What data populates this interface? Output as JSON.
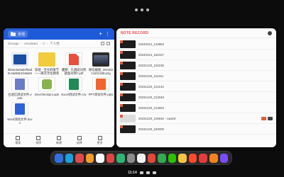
{
  "file_manager": {
    "header_label": "本地",
    "path": [
      "Storage",
      "emulated",
      "0",
      "个人档"
    ],
    "files": [
      {
        "caption": "3b0ac5e9ab0f83d0c4ad6ab1fa5a84d9ec5a5...",
        "kind": "image"
      },
      {
        "caption": "穿越 · 宝主的暖节——麻苏文化教育",
        "kind": "folder"
      },
      {
        "caption": "董卿：礼貌面对周题面对啊?.pdf",
        "kind": "pdf"
      },
      {
        "caption": "微信截图_20240314101458.png",
        "kind": "screenshot"
      },
      {
        "caption": "古迷信测试文件.epub",
        "kind": "epub"
      },
      {
        "caption": "DevCheckpro.apk",
        "kind": "apk"
      },
      {
        "caption": "Excel测试文件.csv",
        "kind": "csv"
      },
      {
        "caption": "PPT测试文件.pptx",
        "kind": "pptx"
      },
      {
        "caption": "Word测试文件.docx",
        "kind": "docx"
      }
    ],
    "bottom": [
      "搜索",
      "排序",
      "新建",
      "选择",
      "更多"
    ]
  },
  "notes": {
    "title": "NOTE RECORD",
    "rows": [
      {
        "name": "20240314_143853"
      },
      {
        "name": "20240314_150437"
      },
      {
        "name": "20231220_210235"
      },
      {
        "name": "20231220_211311"
      },
      {
        "name": "20231220_212142"
      },
      {
        "name": "20231220_213048"
      },
      {
        "name": "20231220_213553"
      },
      {
        "name": "20231220_215845 - copied"
      },
      {
        "name": "20231220_220005"
      }
    ]
  },
  "dock": {
    "apps": [
      {
        "name": "browser-icon",
        "color": "#2f6fe0"
      },
      {
        "name": "bird-icon",
        "color": "#1aa1e0"
      },
      {
        "name": "dual-icon",
        "color": "#e24a4a"
      },
      {
        "name": "photos-icon",
        "color": "#f29b2b"
      },
      {
        "name": "camera-icon",
        "color": "#ffffff"
      },
      {
        "name": "message-icon",
        "color": "#e24545"
      },
      {
        "name": "green-app-icon",
        "color": "#2bb673"
      },
      {
        "name": "settings-icon",
        "color": "#8b8b8b"
      },
      {
        "name": "clock-icon",
        "color": "#f2f2f2"
      },
      {
        "name": "app-store-icon",
        "color": "#e8453c"
      },
      {
        "name": "chrome-icon",
        "color": "#34a853"
      },
      {
        "name": "wechat-icon",
        "color": "#2dc100"
      },
      {
        "name": "notes-icon",
        "color": "#f5c542"
      },
      {
        "name": "office-icon",
        "color": "#ff4b2b"
      },
      {
        "name": "wps-icon",
        "color": "#e63b3b"
      },
      {
        "name": "media-icon",
        "color": "#f58220"
      },
      {
        "name": "music-icon",
        "color": "#7a4cff"
      }
    ]
  },
  "status": {
    "time": "11:14"
  }
}
